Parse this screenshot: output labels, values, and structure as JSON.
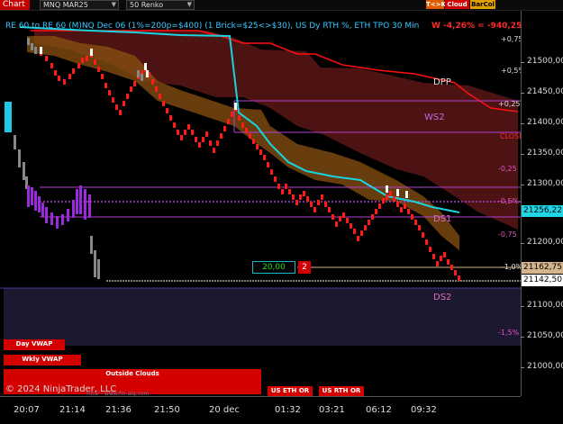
{
  "toolbar": {
    "chart_label": "Chart",
    "instrument": "MNQ MAR25",
    "bar_type": "50 Renko",
    "btn_tk": "T<>K",
    "btn_cloud": "Cloud",
    "btn_barcol": "BarCol"
  },
  "chart": {
    "header": "RE 60 to RE 60 (M)NQ Dec 06 (1%=200p=$400) (1 Brick=$25<>$30), US Dy RTH %, ETH TPO 30 Min",
    "weekly_change": "W -4,26% = -940,25",
    "pct_labels": [
      "+0,75",
      "+0,5%",
      "+0,25",
      "CLOSE",
      "-0,25",
      "-0,5%",
      "-0,75",
      "-1,0%",
      "-1,5%"
    ],
    "levels": {
      "dpp": "DPP",
      "ws2": "WS2",
      "ds1": "DS1",
      "ds2": "DS2"
    },
    "tick_box_value": "20,00",
    "tick_box_count": "2",
    "copyright": "© 2024 NinjaTrader, LLC",
    "watermark": "Final - www.fin-alg.com",
    "colors": {
      "up_brick": "#ffffff",
      "down_brick": "#ff1a1a",
      "cloud_red": "#5a1515",
      "cloud_orange": "#8a5212",
      "vwap": "#19d3e0",
      "level_line": "#b040d0",
      "resistance": "#ff1010"
    }
  },
  "yaxis": {
    "ticks": [
      "21500,00",
      "21450,00",
      "21400,00",
      "21350,00",
      "21300,00",
      "21250,00",
      "21200,00",
      "21150,00",
      "21100,00",
      "21050,00",
      "21000,00"
    ],
    "vwap_price": "21256,22",
    "level_price": "21162,75",
    "last_price": "21142,50"
  },
  "xaxis": {
    "ticks": [
      "20:07",
      "21:14",
      "21:36",
      "21:50",
      "20 dec",
      "01:32",
      "03:21",
      "06:12",
      "09:32"
    ]
  },
  "panel": {
    "day_vwap": "Day VWAP",
    "wkly_vwap": "Wkly VWAP",
    "outside_clouds": "Outside Clouds",
    "us_eth_or": "US ETH OR",
    "us_rth_or": "US RTH OR"
  }
}
